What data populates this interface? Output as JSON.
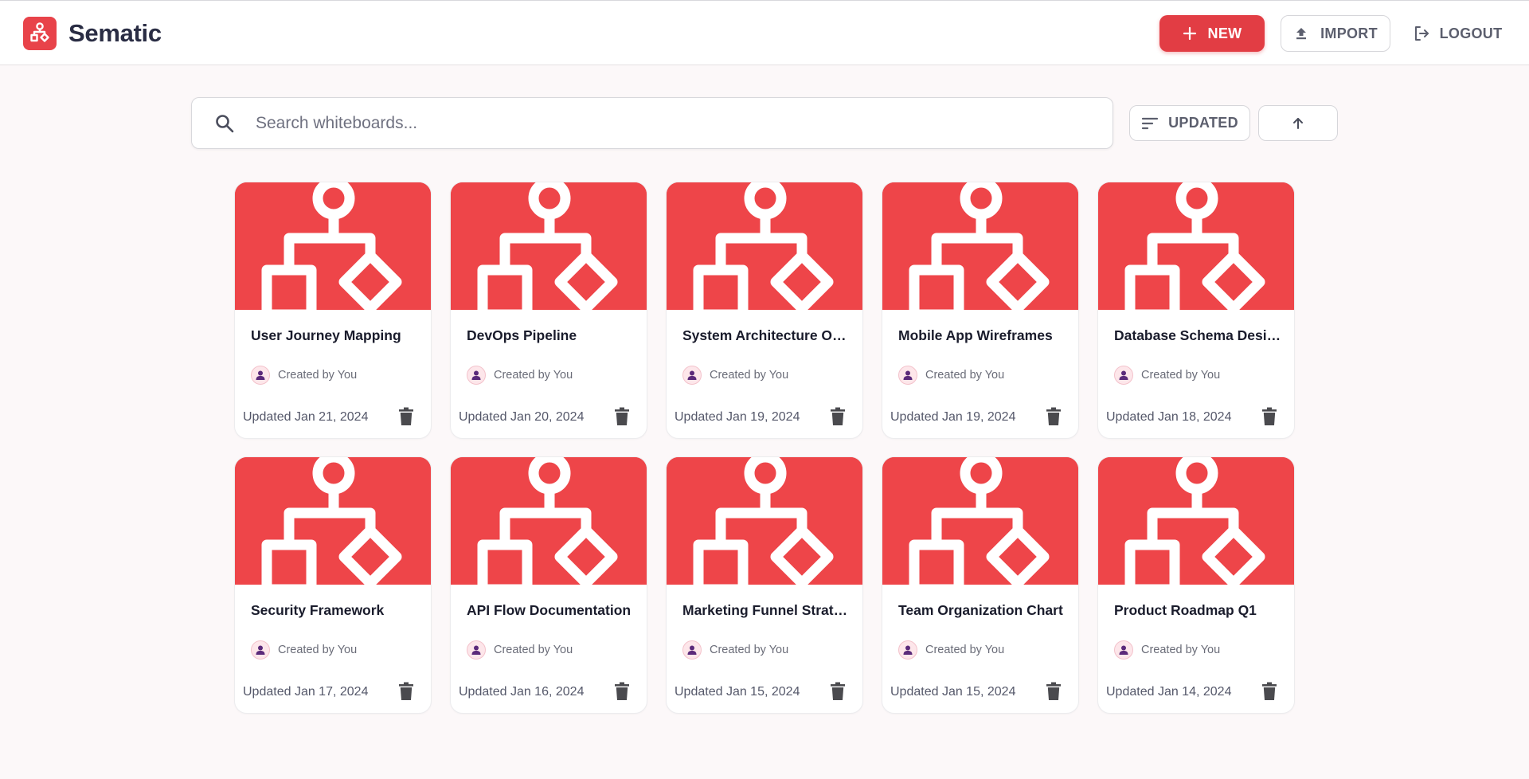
{
  "app": {
    "name": "Sematic"
  },
  "toolbar": {
    "new_label": "NEW",
    "import_label": "IMPORT",
    "logout_label": "LOGOUT"
  },
  "search": {
    "placeholder": "Search whiteboards...",
    "value": ""
  },
  "sort": {
    "field_label": "UPDATED",
    "direction": "ascending"
  },
  "colors": {
    "accent": "#e23d44",
    "thumbnail": "#ee4549",
    "background": "#fcf8f9"
  },
  "icons": {
    "logo": "flowchart-icon",
    "new": "plus-icon",
    "import": "upload-icon",
    "logout": "logout-icon",
    "search": "search-icon",
    "sort": "sort-lines-icon",
    "order": "arrow-up-icon",
    "thumbnail": "flowchart-icon",
    "avatar": "person-icon",
    "delete": "trash-icon"
  },
  "boards": [
    {
      "title": "User Journey Mapping",
      "creator": "Created by You",
      "updated": "Updated Jan 21, 2024"
    },
    {
      "title": "DevOps Pipeline",
      "creator": "Created by You",
      "updated": "Updated Jan 20, 2024"
    },
    {
      "title": "System Architecture Overview",
      "creator": "Created by You",
      "updated": "Updated Jan 19, 2024"
    },
    {
      "title": "Mobile App Wireframes",
      "creator": "Created by You",
      "updated": "Updated Jan 19, 2024"
    },
    {
      "title": "Database Schema Design",
      "creator": "Created by You",
      "updated": "Updated Jan 18, 2024"
    },
    {
      "title": "Security Framework",
      "creator": "Created by You",
      "updated": "Updated Jan 17, 2024"
    },
    {
      "title": "API Flow Documentation",
      "creator": "Created by You",
      "updated": "Updated Jan 16, 2024"
    },
    {
      "title": "Marketing Funnel Strategy",
      "creator": "Created by You",
      "updated": "Updated Jan 15, 2024"
    },
    {
      "title": "Team Organization Chart",
      "creator": "Created by You",
      "updated": "Updated Jan 15, 2024"
    },
    {
      "title": "Product Roadmap Q1",
      "creator": "Created by You",
      "updated": "Updated Jan 14, 2024"
    }
  ]
}
